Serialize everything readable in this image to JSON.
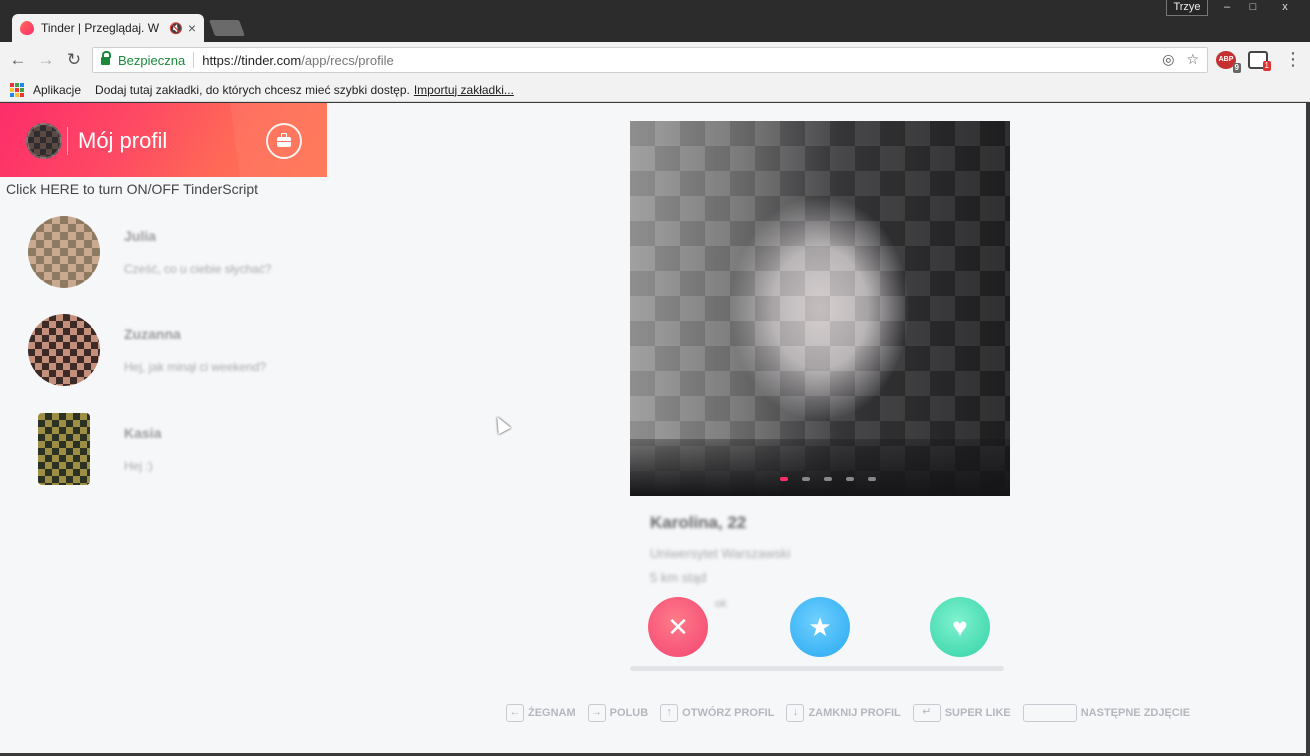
{
  "browser": {
    "tab_title": "Tinder | Przeglądaj. W",
    "profile_name": "Trzye",
    "window_minimize": "–",
    "window_maximize": "□",
    "window_close": "x",
    "back_glyph": "←",
    "forward_glyph": "→",
    "reload_glyph": "↻",
    "security_label": "Bezpieczna",
    "url_host": "https://tinder.com",
    "url_path": "/app/recs/profile",
    "abp_label": "ABP",
    "abp_badge": "9",
    "ext2_badge": "1",
    "menu_glyph": "⋮",
    "location_icon": "◎",
    "star_icon": "☆"
  },
  "bookmarks": {
    "apps_label": "Aplikacje",
    "hint_text": "Dodaj tutaj zakładki, do których chcesz mieć szybki dostęp.",
    "import_link": "Importuj zakładki..."
  },
  "sidebar": {
    "title": "Mój profil",
    "script_toggle": "Click HERE to turn ON/OFF TinderScript",
    "matches": [
      {
        "name": "Julia",
        "preview": "Cześć, co u ciebie słychać?"
      },
      {
        "name": "Zuzanna",
        "preview": "Hej, jak minął ci weekend?"
      },
      {
        "name": "Kasia",
        "preview": "Hej :)"
      }
    ]
  },
  "card": {
    "name_age": "Karolina, 22",
    "line1": "Uniwersytet Warszawski",
    "line2": "5 km stąd",
    "line3": "ok",
    "photo_count": 5,
    "active_photo": 0
  },
  "actions": {
    "nope_glyph": "✕",
    "super_glyph": "★",
    "like_glyph": "♥"
  },
  "hints": [
    {
      "key": "←",
      "label": "ŻEGNAM"
    },
    {
      "key": "→",
      "label": "POLUB"
    },
    {
      "key": "↑",
      "label": "OTWÓRZ PROFIL"
    },
    {
      "key": "↓",
      "label": "ZAMKNIJ PROFIL"
    },
    {
      "key": "↵",
      "label": "SUPER LIKE"
    },
    {
      "key": "",
      "label": "NASTĘPNE ZDJĘCIE"
    }
  ],
  "colors": {
    "brand_gradient_start": "#fd2d6a",
    "brand_gradient_end": "#ff7452",
    "secure_green": "#1b8a3b",
    "nope": "#f24470",
    "super": "#28a8f0",
    "like": "#32d2a6"
  }
}
